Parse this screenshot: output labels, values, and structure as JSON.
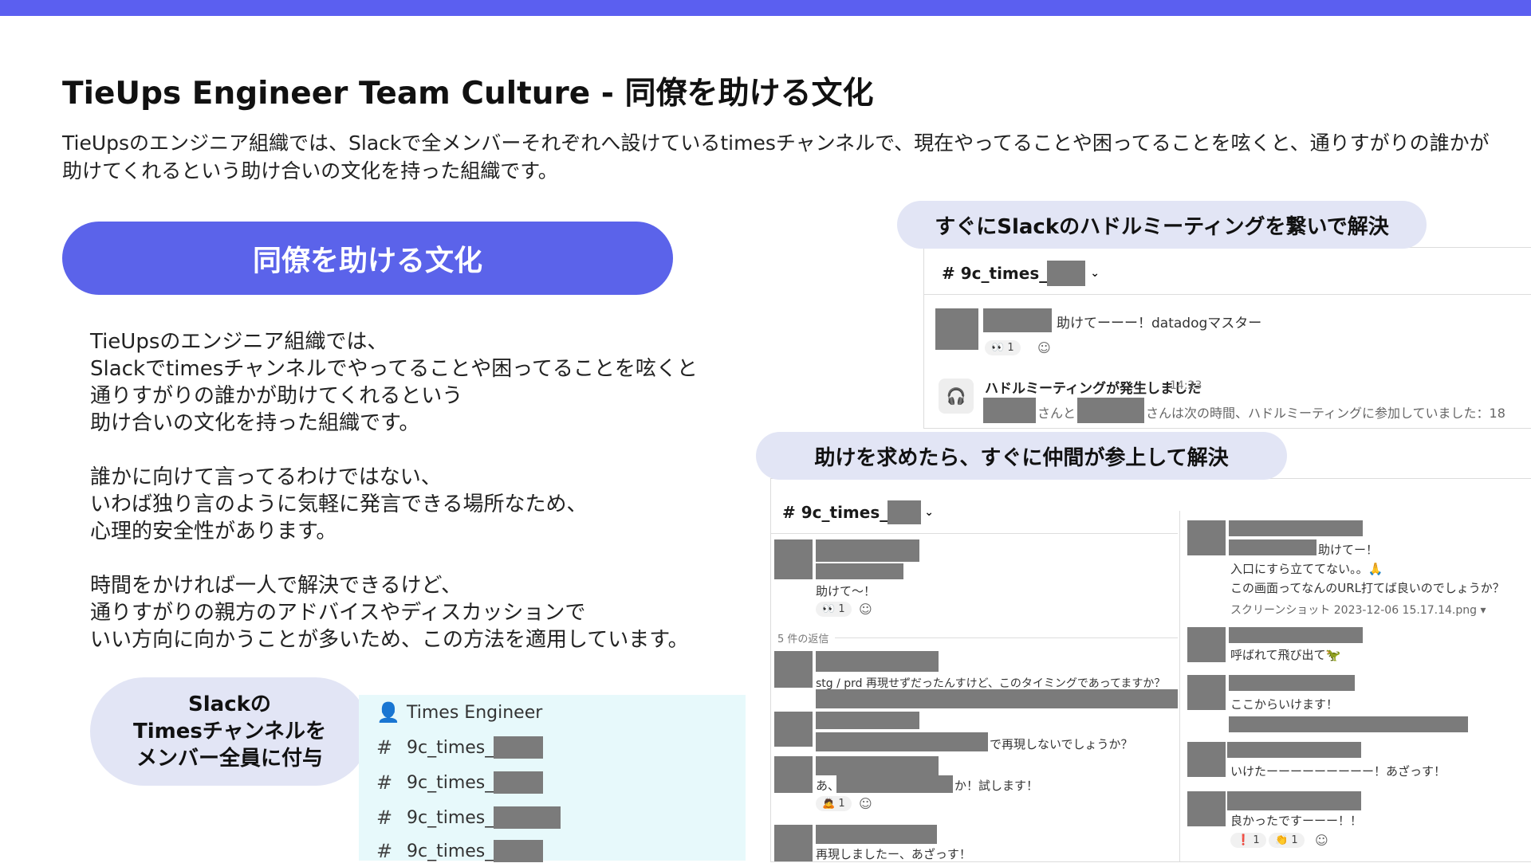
{
  "colors": {
    "accent": "#5b63ea",
    "topbar": "#5b5ff0",
    "pill_light": "#e2e5f5",
    "redaction": "#7b7b7b",
    "sidebar_bg": "#e7f9fb"
  },
  "title": "TieUps Engineer Team Culture - 同僚を助ける文化",
  "intro": "TieUpsのエンジニア組織では、Slackで全メンバーそれぞれへ設けているtimesチャンネルで、現在やってることや困ってることを呟くと、通りすがりの誰かが助けてくれるという助け合いの文化を持った組織です。",
  "main_pill": "同僚を助ける文化",
  "body": {
    "p1": "TieUpsのエンジニア組織では、\nSlackでtimesチャンネルでやってることや困ってることを呟くと\n通りすがりの誰かが助けてくれるという\n助け合いの文化を持った組織です。",
    "p2": "誰かに向けて言ってるわけではない、\nいわば独り言のように気軽に発言できる場所なため、\n心理的安全性があります。",
    "p3": "時間をかければ一人で解決できるけど、\n通りすがりの親方のアドバイスやディスカッションで\nいい方向に向かうことが多いため、この方法を適用しています。"
  },
  "side_pill": "Slackの\nTimesチャンネルを\nメンバー全員に付与",
  "sidebar": {
    "section_icon": "person-icon",
    "section_label": "Times Engineer",
    "channels": [
      "9c_times_",
      "9c_times_",
      "9c_times_",
      "9c_times_"
    ]
  },
  "huddle": {
    "label": "すぐにSlackのハドルミーティングを繋いで解決",
    "channel": "9c_times_",
    "msg1": "助けてーーー！datadogマスター",
    "msg1_reaction_emoji": "👀",
    "msg1_reaction_count": "1",
    "huddle_title": "ハドルミーティングが発生しました",
    "huddle_time": "14:23",
    "huddle_and": "さんと",
    "huddle_desc": "さんは次の時間、ハドルミーティングに参加していました：18"
  },
  "help": {
    "label": "助けを求めたら、すぐに仲間が参上して解決",
    "channel": "9c_times_",
    "left": {
      "msg1": "助けて〜！",
      "msg1_reaction_emoji": "👀",
      "msg1_reaction_count": "1",
      "replies": "5 件の返信",
      "msg2": "stg / prd 再現せずだったんすけど、このタイミングであってますか？",
      "msg3": "で再現しないでしょうか？",
      "msg4_a": "あ、",
      "msg4_b": "か！試します！",
      "msg4_reaction_emoji": "🙇",
      "msg4_reaction_count": "1",
      "msg5": "再現しましたー、あざっす！"
    },
    "right": {
      "msg1": "助けてー！",
      "msg2": "入口にすら立ててない。。",
      "msg2_emoji": "🙏",
      "msg3": "この画面ってなんのURL打てば良いのでしょうか？",
      "msg4": "スクリーンショット 2023-12-06 15.17.14.png ▾",
      "msg5": "呼ばれて飛び出て",
      "msg5_emoji": "🦖",
      "msg6": "ここからいけます！",
      "msg7": "いけたーーーーーーーーー！あざっす！",
      "msg8": "良かったですーーー！！",
      "msg8_reaction1_emoji": "❗",
      "msg8_reaction1_count": "1",
      "msg8_reaction2_emoji": "👏",
      "msg8_reaction2_count": "1"
    }
  }
}
